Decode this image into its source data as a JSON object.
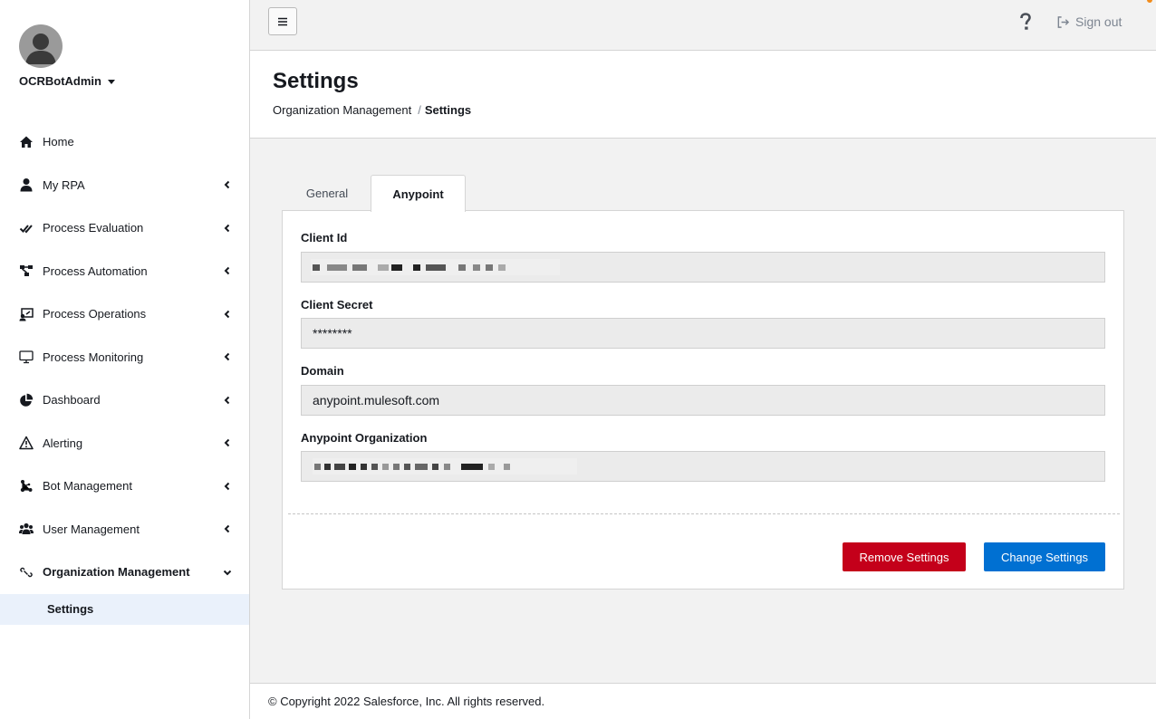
{
  "user": {
    "name": "OCRBotAdmin"
  },
  "sidebar": {
    "items": [
      {
        "label": "Home",
        "icon": "home-icon"
      },
      {
        "label": "My RPA",
        "icon": "user-icon"
      },
      {
        "label": "Process Evaluation",
        "icon": "check-double-icon"
      },
      {
        "label": "Process Automation",
        "icon": "flow-icon"
      },
      {
        "label": "Process Operations",
        "icon": "operations-icon"
      },
      {
        "label": "Process Monitoring",
        "icon": "monitor-icon"
      },
      {
        "label": "Dashboard",
        "icon": "pie-chart-icon"
      },
      {
        "label": "Alerting",
        "icon": "warning-icon"
      },
      {
        "label": "Bot Management",
        "icon": "bot-icon"
      },
      {
        "label": "User Management",
        "icon": "users-icon"
      },
      {
        "label": "Organization Management",
        "icon": "link-icon"
      }
    ],
    "sub_items": [
      {
        "label": "Settings"
      }
    ]
  },
  "topbar": {
    "signout_label": "Sign out"
  },
  "header": {
    "title": "Settings",
    "breadcrumb": {
      "parent": "Organization Management",
      "separator": "/",
      "current": "Settings"
    }
  },
  "tabs": [
    {
      "label": "General"
    },
    {
      "label": "Anypoint"
    }
  ],
  "form": {
    "client_id": {
      "label": "Client Id"
    },
    "client_secret": {
      "label": "Client Secret",
      "value": "********"
    },
    "domain": {
      "label": "Domain",
      "value": "anypoint.mulesoft.com"
    },
    "organization": {
      "label": "Anypoint Organization"
    }
  },
  "buttons": {
    "remove": "Remove Settings",
    "change": "Change Settings"
  },
  "footer": {
    "copyright": "© Copyright 2022 Salesforce, Inc. All rights reserved."
  },
  "colors": {
    "danger": "#c4001a",
    "primary": "#0070d2",
    "notification": "#f28c1b",
    "active_bg": "#eaf1fb"
  }
}
